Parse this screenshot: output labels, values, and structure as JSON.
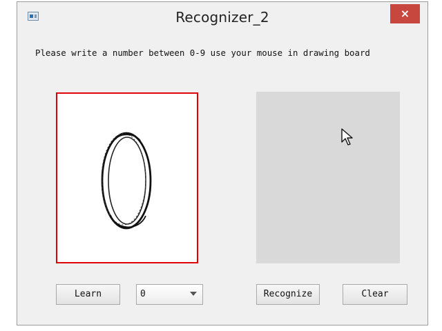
{
  "window": {
    "title": "Recognizer_2",
    "close_label": "×"
  },
  "instruction": "Please write a number between 0-9 use your mouse in drawing board",
  "drawing_board": {
    "drawn_digit_icon": "handwritten-zero-stroke",
    "border_color": "#e00000"
  },
  "buttons": {
    "learn": "Learn",
    "recognize": "Recognize",
    "clear": "Clear"
  },
  "digit_select": {
    "value": "0"
  },
  "colors": {
    "close_button": "#c7463e",
    "result_panel": "#d9d9d9"
  }
}
